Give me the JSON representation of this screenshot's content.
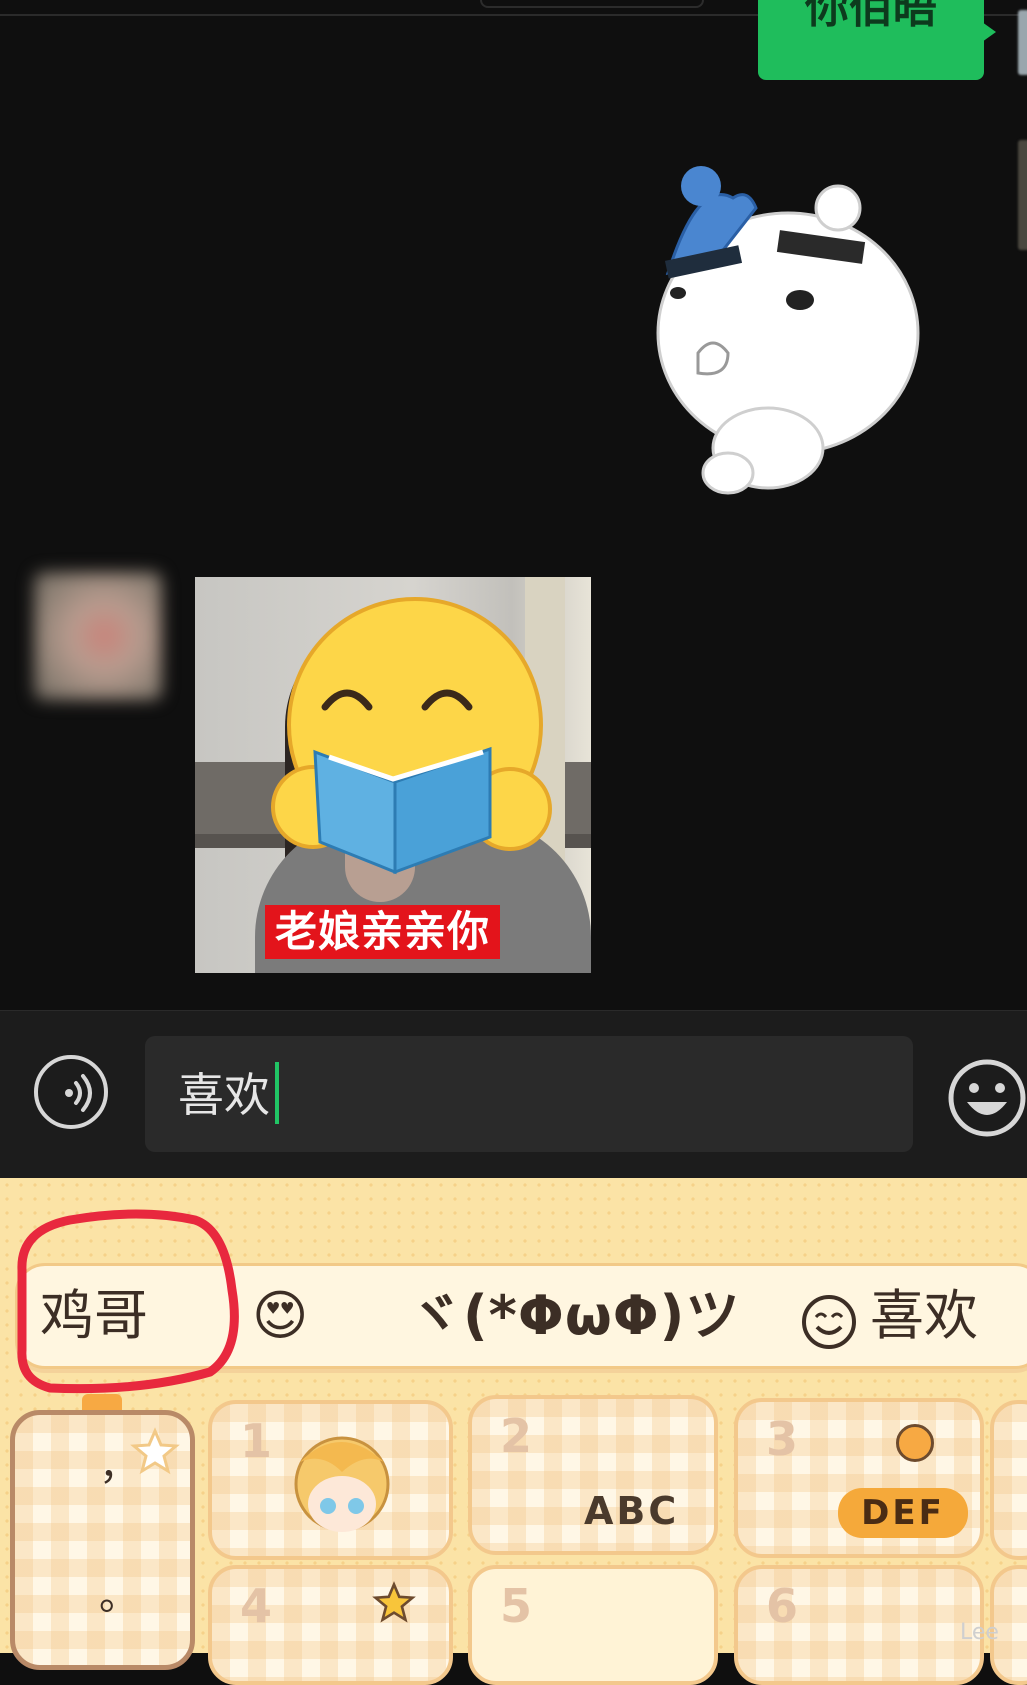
{
  "chat": {
    "outgoing_text": "你佰晤",
    "image_caption": "老娘亲亲你"
  },
  "input": {
    "value": "喜欢"
  },
  "keyboard": {
    "candidates": [
      "鸡哥",
      "😍",
      "ヾ(*ΦωΦ)ツ",
      "喜欢"
    ],
    "keys": {
      "left_top": "，",
      "left_bottom": "。",
      "k1": "1",
      "k2": "2",
      "k2_sub": "ABC",
      "k3": "3",
      "k3_sub": "DEF",
      "k4": "4",
      "k5": "5",
      "k6": "6"
    }
  },
  "watermark": "Lee",
  "colors": {
    "bubble_green": "#1fbd5c",
    "caret": "#21c565",
    "highlight_circle": "#e8283e",
    "keyboard_bg": "#fbe3a6"
  }
}
